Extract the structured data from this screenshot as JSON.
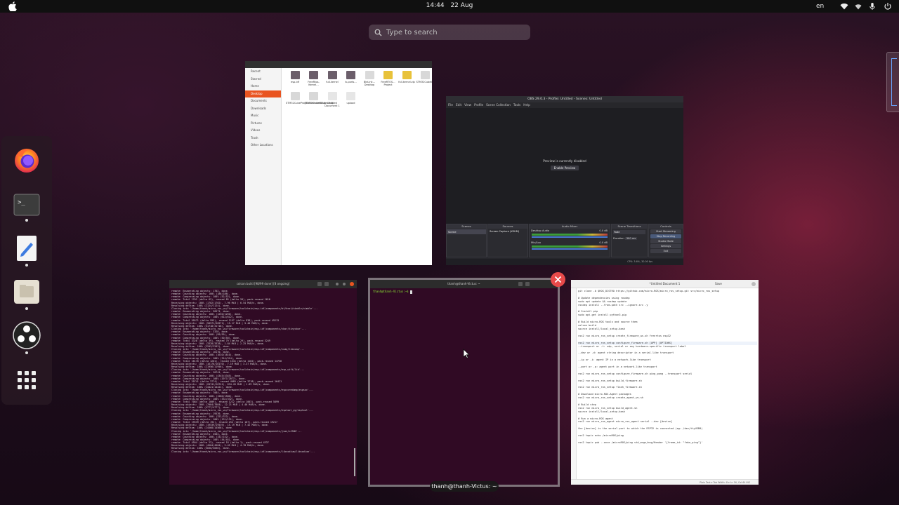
{
  "topbar": {
    "time": "14:44",
    "date": "22 Aug",
    "language": "en"
  },
  "search": {
    "placeholder": "Type to search"
  },
  "dock": {
    "apps": [
      "firefox-icon",
      "terminal-icon",
      "text-editor-icon",
      "files-icon",
      "obs-studio-icon",
      "show-apps-icon"
    ]
  },
  "files_window": {
    "sidebar": [
      "Recent",
      "Starred",
      "Home",
      "Desktop",
      "Documents",
      "Downloads",
      "Music",
      "Pictures",
      "Videos",
      "Trash",
      "Other Locations"
    ],
    "files": [
      {
        "name": "esp-idf",
        "color": "#6b5e6a"
      },
      {
        "name": "FreeRtos-Kernel…",
        "color": "#6b5e6a"
      },
      {
        "name": "full-kernel",
        "color": "#6b5e6a"
      },
      {
        "name": "lv-ports…",
        "color": "#6b5e6a"
      },
      {
        "name": "BleLink…Desktop",
        "color": "#dadada"
      },
      {
        "name": "FreeRTOS…Project",
        "color": "#e8c23a"
      },
      {
        "name": "full-kernel.zip",
        "color": "#e8c23a"
      },
      {
        "name": "STM32CubeIDE",
        "color": "#d8d8d8"
      },
      {
        "name": "STM32CubeProgrammer.desktop",
        "color": "#d8d8d8"
      },
      {
        "name": "STM32CubeMX.desktop",
        "color": "#d8d8d8"
      },
      {
        "name": "Untitled Document 1",
        "color": "#e6e6e6"
      },
      {
        "name": "upload",
        "color": "#e6e6e6"
      }
    ]
  },
  "obs_window": {
    "title": "OBS 29.0.3 - Profile: Untitled - Scenes: Untitled",
    "menu": [
      "File",
      "Edit",
      "View",
      "Profile",
      "Scene Collection",
      "Tools",
      "Help"
    ],
    "preview_text": "Preview is currently disabled",
    "enable_preview": "Enable Preview",
    "panels": {
      "scenes": "Scenes",
      "sources": "Sources",
      "audio_mixer": "Audio Mixer",
      "transitions": "Scene Transitions",
      "controls": "Controls"
    },
    "scene_item": "Scene",
    "source_item": "Screen Capture (XSHM)",
    "audio_desktop": "Desktop Audio",
    "audio_mic": "Mic/Aux",
    "audio_db_1": "0.0 dB",
    "audio_db_2": "0.0 dB",
    "transition_value": "Fade",
    "duration_label": "Duration",
    "duration_value": "300 ms",
    "control_buttons": [
      "Start Streaming",
      "Stop Recording",
      "Studio Mode",
      "Settings",
      "Exit"
    ],
    "status": "CPU: 3.6%, 30.00 fps"
  },
  "term1_window": {
    "title": "colcon build [98/99 done] [8 ongoing]",
    "lines": [
      "remote: Enumerating objects: 1702, done.",
      "remote: Counting objects: 100% (186/186), done.",
      "remote: Compressing objects: 100% (52/52), done.",
      "remote: Total 1702 (delta 62), reused 85 (delta 28), pack-reused 1616",
      "Receiving objects: 100% (1702/1702), 7.96 MiB | 6.54 MiB/s, done.",
      "Resolving deltas: 100% (1124/1124), done.",
      "Cloning into '/home/thanh/micro_ros_ws/firmware/toolchain/esp-idf/components/bt/host/nimble/nimble'...",
      "remote: Enumerating objects: 50571, done.",
      "remote: Counting objects: 100% (1250/1250), done.",
      "remote: Compressing objects: 100% (612/612), done.",
      "remote: Total 50571 (delta 995), reused 1197 (delta 838), pack-reused 49213",
      "Receiving objects: 100% (50571/50571), 15.17 MiB | 5.40 MiB/s, done.",
      "Resolving deltas: 100% (31718/31718), done.",
      "Cloning into '/home/thanh/micro_ros_ws/firmware/toolchain/esp-idf/components/cbor/tinycbor'...",
      "remote: Enumerating objects: 3328, done.",
      "remote: Counting objects: 100% (99/99), done.",
      "remote: Compressing objects: 100% (50/50), done.",
      "remote: Total 3328 (delta 39), reused 79 (delta 29), pack-reused 3249",
      "Receiving objects: 100% (3328/3328), 1.84 MiB | 2.25 MiB/s, done.",
      "Resolving deltas: 100% (2203/2203), done.",
      "Cloning into '/home/thanh/micro_ros_ws/firmware/toolchain/esp-idf/components/coap/libcoap'...",
      "remote: Enumerating objects: 16170, done.",
      "remote: Counting objects: 100% (1610/1610), done.",
      "remote: Compressing objects: 100% (314/314), done.",
      "remote: Total 16170 (delta 1201), reused 1541 (delta 1162), pack-reused 14736",
      "Receiving objects: 100% (16170/16170), 7.19 MiB | 3.37 MiB/s, done.",
      "Resolving deltas: 100% (11956/11956), done.",
      "Cloning into '/home/thanh/micro_ros_ws/firmware/toolchain/esp-idf/components/esp_wifi/lib'...",
      "remote: Enumerating objects: 20741, done.",
      "remote: Counting objects: 100% (4345/4345), done.",
      "remote: Compressing objects: 100% (2077/2077), done.",
      "remote: Total 20741 (delta 3774), reused 4085 (delta 3718), pack-reused 16421",
      "Receiving objects: 100% (20741/20741), 634.45 MiB | 1.89 MiB/s, done.",
      "Resolving deltas: 100% (14421/14421), done.",
      "Cloning into '/home/thanh/micro_ros_ws/firmware/toolchain/esp-idf/components/espcoredump/espsoc'...",
      "remote: Enumerating objects: 7084, done.",
      "remote: Counting objects: 100% (1580/1580), done.",
      "remote: Compressing objects: 100% (332/332), done.",
      "remote: Total 7084 (delta 1009), reused 1222 (delta 1003), pack-reused 5899",
      "Receiving objects: 100% (7084/7084), 12.21 MiB | 4.40 MiB/s, done.",
      "Resolving deltas: 100% (4777/4777), done.",
      "Cloning into '/home/thanh/micro_ros_ws/firmware/toolchain/esp-idf/components/esptool_py/esptool'...",
      "remote: Enumerating objects: 19539, done.",
      "remote: Counting objects: 100% (322/322), done.",
      "remote: Compressing objects: 100% (131/131), done.",
      "remote: Total 19539 (delta 192), reused 254 (delta 107), pack-reused 19217",
      "Receiving objects: 100% (19539/19539), 15.19 MiB | 7.42 MiB/s, done.",
      "Resolving deltas: 100% (14568/14568), done.",
      "Cloning into '/home/thanh/micro_ros_ws/firmware/toolchain/esp-idf/components/json/cJSON'...",
      "remote: Enumerating objects: 4504, done.",
      "remote: Counting objects: 100% (152/152), done.",
      "remote: Compressing objects: 100% (44/44), done.",
      "remote: Total 4504 (delta 23), reused 18 (delta 1), pack-reused 4337",
      "Receiving objects: 100% (4504/4504), 2.45 MiB | 4.70 MiB/s, done.",
      "Resolving deltas: 100% (3030/3030), done.",
      "Cloning into '/home/thanh/micro_ros_ws/firmware/toolchain/esp-idf/components/libsodium/libsodium'..."
    ]
  },
  "term2_window": {
    "title": "thanh@thanh-Victus: ~",
    "prompt": "thanh@thanh-Victus:~$ ",
    "label": "thanh@thanh-Victus: ~"
  },
  "edit_window": {
    "title": "*Untitled Document 1",
    "save": "Save",
    "lines": [
      "git clone -b $ROS_DISTRO https://github.com/micro-ROS/micro_ros_setup.git src/micro_ros_setup",
      "",
      "# Update dependencies using rosdep",
      "sudo apt update && rosdep update",
      "rosdep install --from-path src --ignore-src -y",
      "",
      "# Install pip",
      "sudo apt-get install python3-pip",
      "",
      "# Build micro-ROS tools and source them",
      "colcon build",
      "source install/local_setup.bash",
      "",
      "ros2 run micro_ros_setup create_firmware_ws.sh freertos esp32",
      "",
      "ros2 run micro_ros_setup configure_firmware.sh [APP] [OPTIONS]",
      "--transport or -t: udp, serial or any hardware-specific transport label",
      "",
      "--dev or -d: agent string descriptor in a serial-like transport",
      "",
      "--ip or -i: agent IP in a network-like transport",
      "",
      "--port or -p: agent port in a network-like transport",
      "",
      "ros2 run micro_ros_setup configure_firmware.sh ping_pong --transport serial",
      "",
      "ros2 run micro_ros_setup build_firmware.sh",
      "",
      "ros2 run micro_ros_setup flash_firmware.sh",
      "",
      "# Download micro-ROS-Agent packages",
      "ros2 run micro_ros_setup create_agent_ws.sh",
      "",
      "# Build step",
      "ros2 run micro_ros_setup build_agent.sh",
      "source install/local_setup.bash",
      "",
      "# Run a micro-ROS agent",
      "ros2 run micro_ros_agent micro_ros_agent serial --dev [device]",
      "",
      "the [device] is the serial port to which the ESP32 is connected (eg: /dev/ttyUSB0)",
      "",
      "ros2 topic echo /microROS/ping",
      "",
      "ros2 topic pub --once /microROS/ping std_msgs/msg/Header '{frame_id: \"fake_ping\"}'"
    ],
    "status": "Plain Text  ▾   Tab Width: 8  ▾   Ln 16, Col 64   INS"
  }
}
